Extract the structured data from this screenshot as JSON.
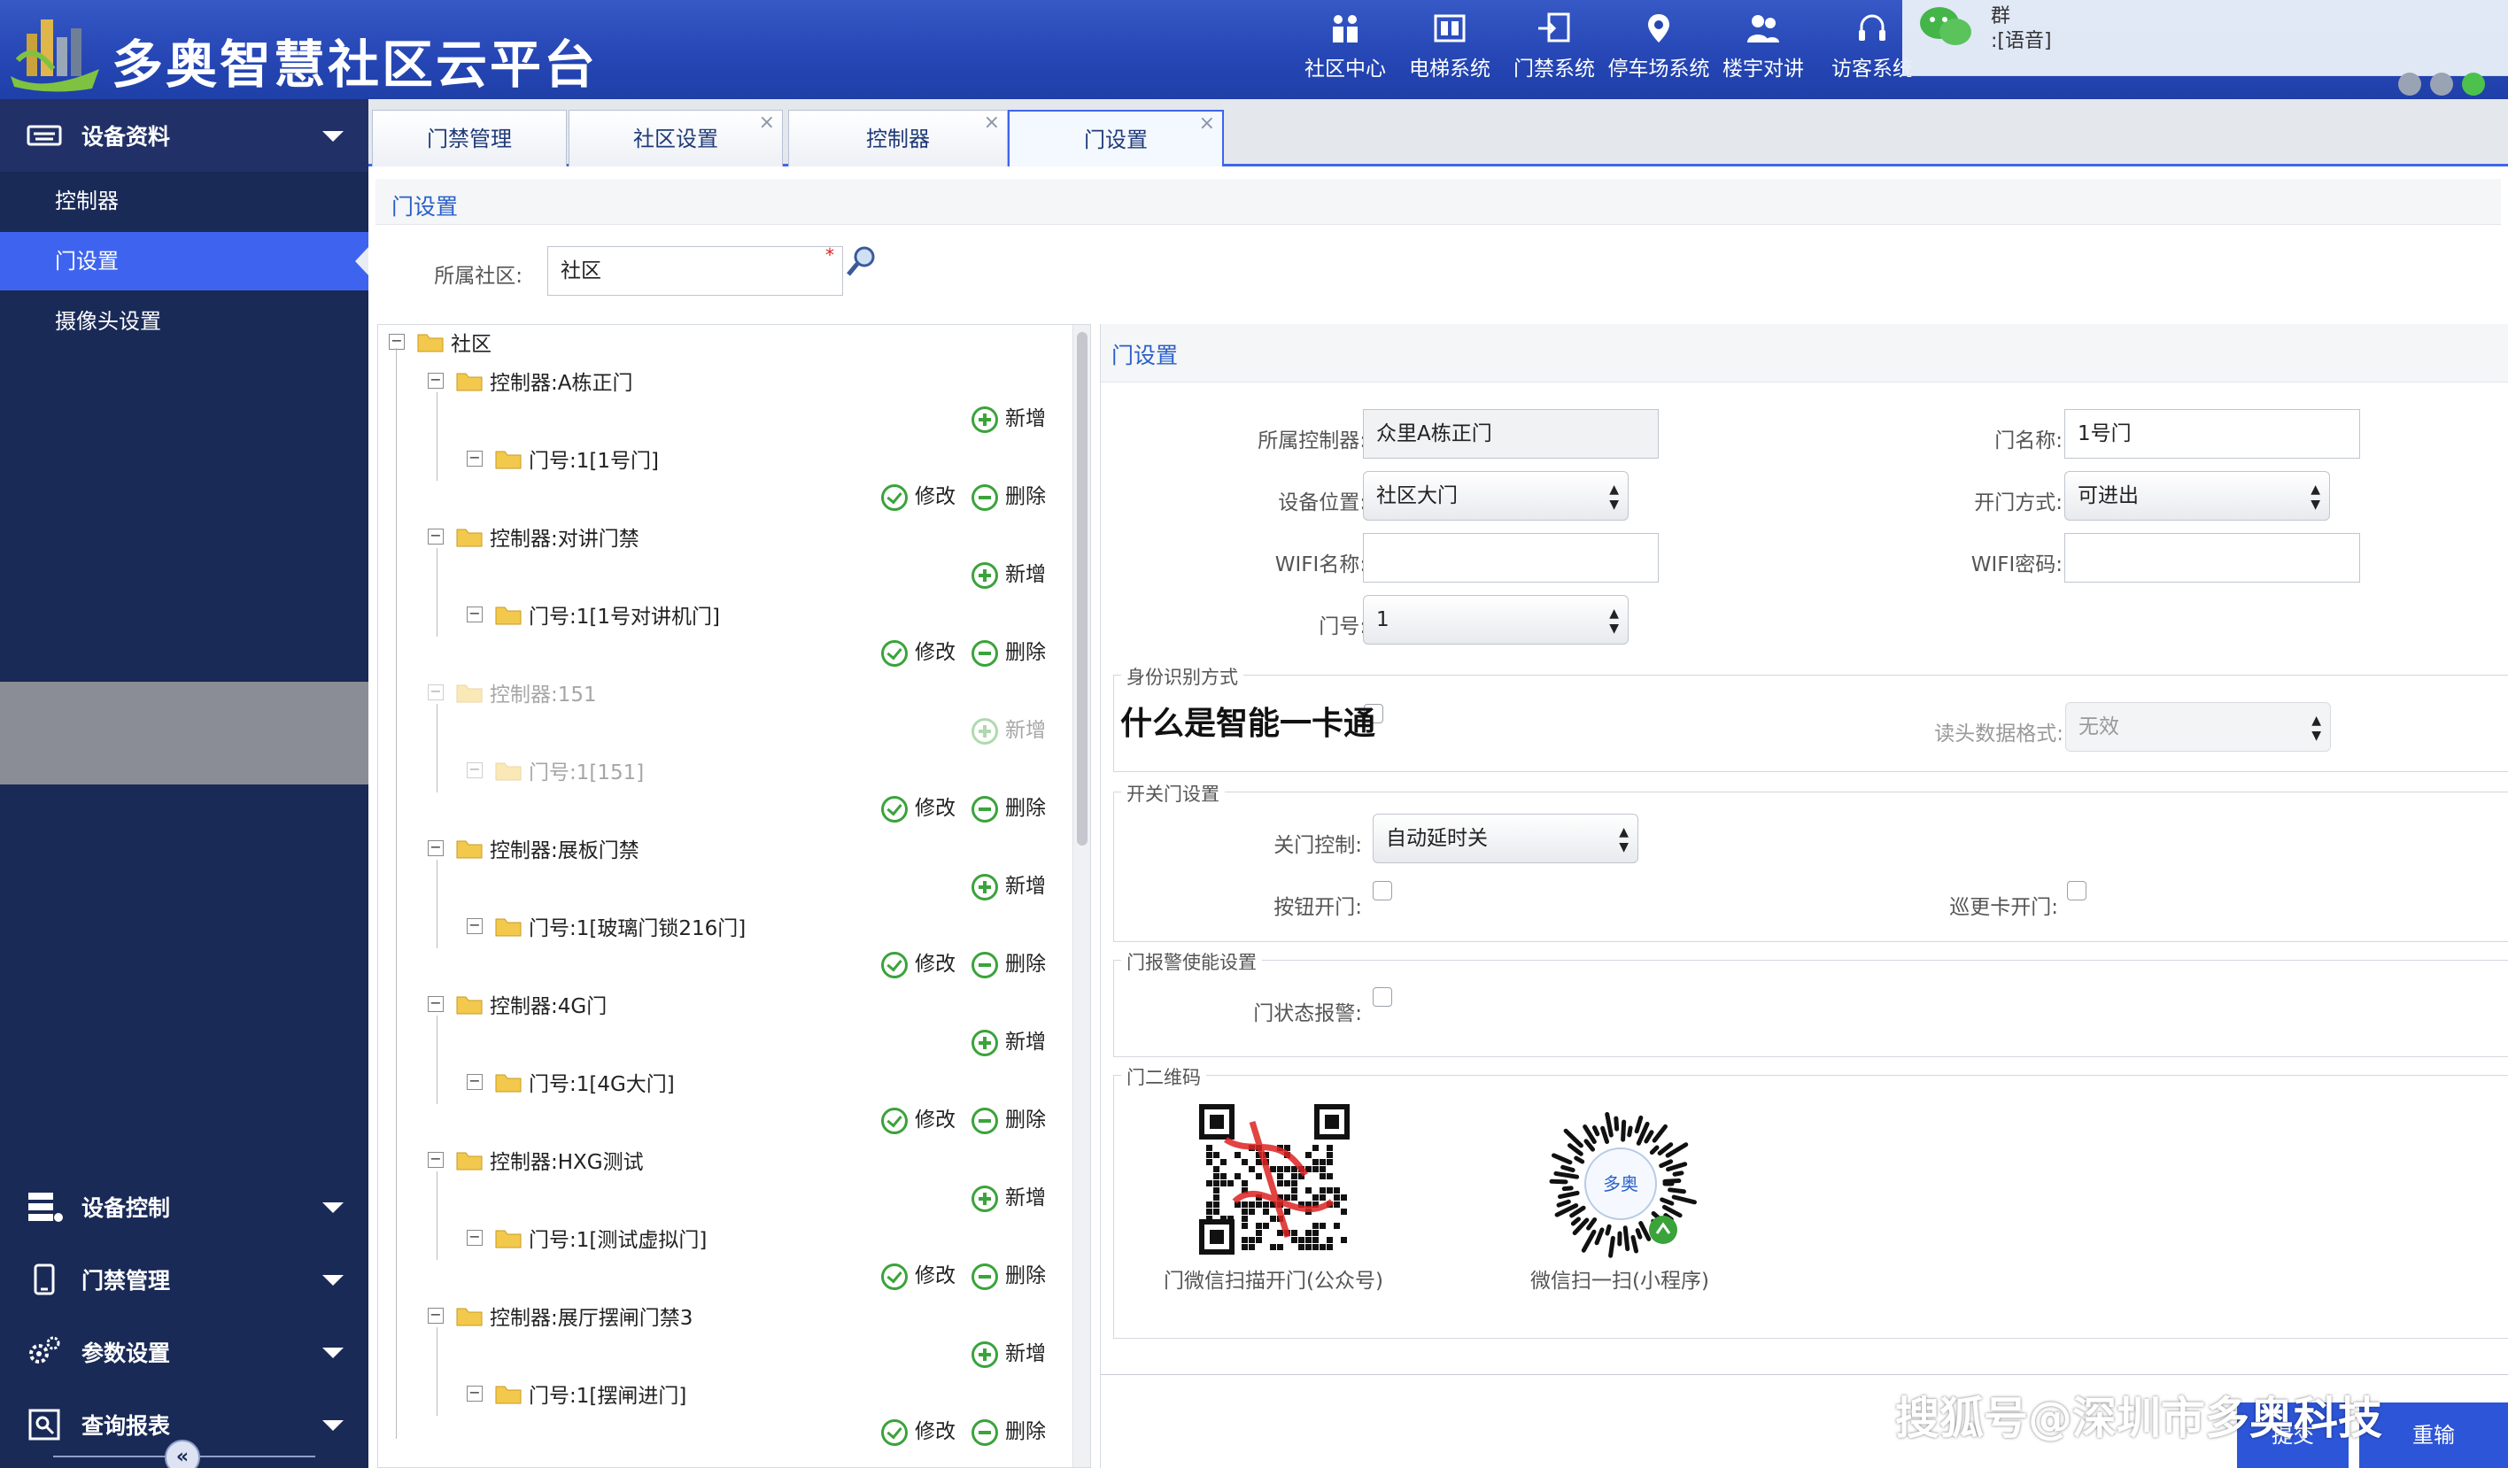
{
  "app": {
    "title": "多奥智慧社区云平台"
  },
  "topnav": [
    {
      "label": "社区中心",
      "icon": "people-icon"
    },
    {
      "label": "电梯系统",
      "icon": "elevator-icon"
    },
    {
      "label": "门禁系统",
      "icon": "door-access-icon"
    },
    {
      "label": "停车场系统",
      "icon": "parking-icon"
    },
    {
      "label": "楼宇对讲",
      "icon": "intercom-icon"
    },
    {
      "label": "访客系统",
      "icon": "headset-icon"
    }
  ],
  "wechat": {
    "group": "群",
    "message": ":[语音]"
  },
  "sidebar": {
    "section1": "设备资料",
    "items": [
      "控制器",
      "门设置",
      "摄像头设置"
    ],
    "sections": [
      "设备控制",
      "门禁管理",
      "参数设置",
      "查询报表"
    ]
  },
  "tabs": [
    {
      "label": "门禁管理",
      "closable": false
    },
    {
      "label": "社区设置",
      "closable": true
    },
    {
      "label": "控制器",
      "closable": true
    },
    {
      "label": "门设置",
      "closable": true,
      "active": true
    }
  ],
  "page": {
    "title": "门设置",
    "community_label": "所属社区:",
    "community_value": "社区",
    "required_mark": "*"
  },
  "tree": {
    "root": "社区",
    "add_label": "新增",
    "edit_label": "修改",
    "delete_label": "删除",
    "nodes": [
      {
        "controller": "控制器:A栋正门",
        "door": "门号:1[1号门]"
      },
      {
        "controller": "控制器:对讲门禁",
        "door": "门号:1[1号对讲机门]"
      },
      {
        "controller": "控制器:151",
        "door": "门号:1[151]"
      },
      {
        "controller": "控制器:展板门禁",
        "door": "门号:1[玻璃门锁216门]"
      },
      {
        "controller": "控制器:4G门",
        "door": "门号:1[4G大门]"
      },
      {
        "controller": "控制器:HXG测试",
        "door": "门号:1[测试虚拟门]"
      },
      {
        "controller": "控制器:展厅摆闸门禁3",
        "door": "门号:1[摆闸进门]"
      }
    ]
  },
  "form": {
    "title": "门设置",
    "controller_label": "所属控制器:",
    "controller_value": "众里A栋正门",
    "door_name_label": "门名称:",
    "door_name_value": "1号门",
    "location_label": "设备位置:",
    "location_value": "社区大门",
    "open_mode_label": "开门方式:",
    "open_mode_value": "可进出",
    "wifi_name_label": "WIFI名称:",
    "wifi_name_value": "",
    "wifi_pwd_label": "WIFI密码:",
    "wifi_pwd_value": "",
    "door_no_label": "门号:",
    "door_no_value": "1",
    "id_legend": "身份识别方式",
    "reader_format_label": "读头数据格式:",
    "reader_format_value": "无效",
    "switch_legend": "开关门设置",
    "close_ctrl_label": "关门控制:",
    "close_ctrl_value": "自动延时关",
    "button_open_label": "按钮开门:",
    "patrol_card_label": "巡更卡开门:",
    "alarm_legend": "门报警使能设置",
    "door_alarm_label": "门状态报警:",
    "qr_legend": "门二维码",
    "qr1_caption": "门微信扫描开门(公众号)",
    "qr2_caption": "微信扫一扫(小程序)",
    "miniapp_logo_text": "多奥"
  },
  "overlay": {
    "text": "什么是智能一卡通"
  },
  "watermark": {
    "text": "搜狐号@深圳市多奥科技"
  },
  "buttons": {
    "submit": "提交",
    "reset": "重输"
  },
  "colors": {
    "header": "#2546b4",
    "sidebar": "#1a2a57",
    "active": "#3e64ef",
    "accent": "#2a5fc8",
    "ok": "#3aa33a"
  }
}
